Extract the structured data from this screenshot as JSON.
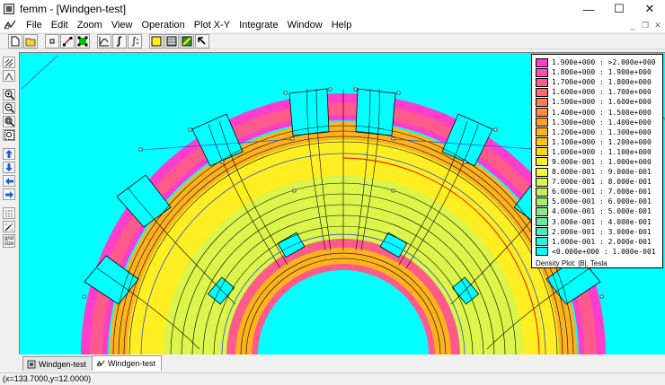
{
  "window": {
    "title": "femm - [Windgen-test]",
    "minimize": "—",
    "maximize": "☐",
    "close": "✕"
  },
  "menu": {
    "items": [
      "File",
      "Edit",
      "Zoom",
      "View",
      "Operation",
      "Plot X-Y",
      "Integrate",
      "Window",
      "Help"
    ],
    "mdi_min": "_",
    "mdi_restore": "❐",
    "mdi_close": "✕"
  },
  "left_toolbar": {
    "grid_label": "grid",
    "size_label": "size"
  },
  "legend": {
    "entries": [
      {
        "label": "1.900e+000 : >2.000e+000",
        "color": "#ff3dcc"
      },
      {
        "label": "1.800e+000 : 1.900e+000",
        "color": "#ff4ea9"
      },
      {
        "label": "1.700e+000 : 1.800e+000",
        "color": "#ff5a8c"
      },
      {
        "label": "1.600e+000 : 1.700e+000",
        "color": "#ff6a6e"
      },
      {
        "label": "1.500e+000 : 1.600e+000",
        "color": "#ff7d56"
      },
      {
        "label": "1.400e+000 : 1.500e+000",
        "color": "#ff8c3f"
      },
      {
        "label": "1.300e+000 : 1.400e+000",
        "color": "#ff9f28"
      },
      {
        "label": "1.200e+000 : 1.300e+000",
        "color": "#ffb21c"
      },
      {
        "label": "1.100e+000 : 1.200e+000",
        "color": "#ffc414"
      },
      {
        "label": "1.000e+000 : 1.100e+000",
        "color": "#ffd812"
      },
      {
        "label": "9.000e-001 : 1.000e+000",
        "color": "#ffee22"
      },
      {
        "label": "8.000e-001 : 9.000e-001",
        "color": "#f4f83c"
      },
      {
        "label": "7.000e-001 : 8.000e-001",
        "color": "#dcf54a"
      },
      {
        "label": "6.000e-001 : 7.000e-001",
        "color": "#c2f05a"
      },
      {
        "label": "5.000e-001 : 6.000e-001",
        "color": "#a6ec6e"
      },
      {
        "label": "4.000e-001 : 5.000e-001",
        "color": "#8ae88a"
      },
      {
        "label": "3.000e-001 : 4.000e-001",
        "color": "#6ee6a6"
      },
      {
        "label": "2.000e-001 : 3.000e-001",
        "color": "#4ce8c4"
      },
      {
        "label": "1.000e-001 : 2.000e-001",
        "color": "#28f2e2"
      },
      {
        "label": "<0.000e+000 : 1.000e-001",
        "color": "#00ffff"
      }
    ],
    "caption": "Density Plot: |B|, Tesla"
  },
  "tabs": [
    {
      "label": "Windgen-test",
      "active": false
    },
    {
      "label": "Windgen-test",
      "active": true
    }
  ],
  "status": {
    "coords": "(x=133.7000,y=12.0000)"
  }
}
